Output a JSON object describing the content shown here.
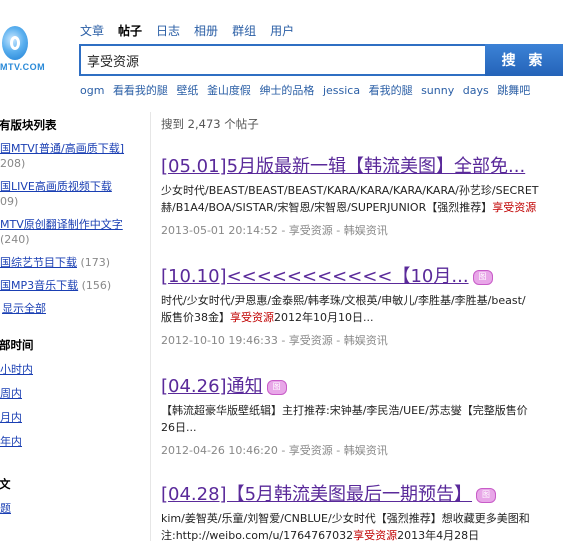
{
  "logo": {
    "text": "MTV.COM"
  },
  "search": {
    "tabs": [
      {
        "label": "文章",
        "active": false
      },
      {
        "label": "帖子",
        "active": true
      },
      {
        "label": "日志",
        "active": false
      },
      {
        "label": "相册",
        "active": false
      },
      {
        "label": "群组",
        "active": false
      },
      {
        "label": "用户",
        "active": false
      }
    ],
    "query": "享受资源",
    "button_label": "搜 索",
    "hot_words": [
      "ogm",
      "看看我的腿",
      "壁纸",
      "釜山度假",
      "绅士的品格",
      "jessica",
      "看我的腿",
      "sunny",
      "days",
      "跳舞吧"
    ]
  },
  "sidebar": {
    "section1_title": "有版块列表",
    "boards": [
      {
        "label": "国MTV[普通/高画质下载]",
        "count": "208)"
      },
      {
        "label": "国LIVE高画质视频下载",
        "count": "09)"
      },
      {
        "label": "MTV原创翻译制作中文字",
        "count": "(240)"
      },
      {
        "label": "国综艺节目下载",
        "count": "(173)"
      },
      {
        "label": "国MP3音乐下载",
        "count": "(156)"
      }
    ],
    "show_all": "显示全部",
    "section2_title": "部时间",
    "time_filters": [
      "小时内",
      "周内",
      "月内",
      "年内"
    ],
    "section3_title": "文",
    "section3_link": "题"
  },
  "results": {
    "count_text": "搜到 2,473 个帖子",
    "items": [
      {
        "title": "[05.01]5月版最新一辑【韩流美图】全部免...",
        "snippet_line1": "少女时代/BEAST/BEAST/BEAST/KARA/KARA/KARA/KARA/孙艺珍/SECRET",
        "snippet_line2_pre": "赫/B1A4/BOA/SISTAR/宋智恩/宋智恩/SUPERJUNIOR【强烈推荐】",
        "snippet_line2_hl": "享受资源",
        "snippet_line2_post": "",
        "meta": "2013-05-01 20:14:52 - 享受资源 - 韩娱资讯"
      },
      {
        "title": "[10.10]<<<<<<<<<<<【10月...",
        "snippet_line1": "时代/少女时代/尹恩惠/金泰熙/韩孝珠/文根英/申敏儿/李胜基/李胜基/beast/",
        "snippet_line2_pre": "版售价38金】",
        "snippet_line2_hl": "享受资源",
        "snippet_line2_post": "2012年10月10日...",
        "meta": "2012-10-10 19:46:33 - 享受资源 - 韩娱资讯"
      },
      {
        "title": "[04.26]通知",
        "snippet_line1": "【韩流超豪华版壁纸辑】主打推荐:宋钟基/李民浩/UEE/苏志燮【完整版售价",
        "snippet_line2_pre": "26日...",
        "snippet_line2_hl": "",
        "snippet_line2_post": "",
        "meta": "2012-04-26 10:46:20 - 享受资源 - 韩娱资讯"
      },
      {
        "title": "[04.28]【5月韩流美图最后一期预告】",
        "snippet_line1": "kim/姜智英/乐童/刘智爱/CNBLUE/少女时代【强烈推荐】想收藏更多美图和",
        "snippet_line2_pre": "注:http://weibo.com/u/1764767032",
        "snippet_line2_hl": "享受资源",
        "snippet_line2_post": "2013年4月28日",
        "meta": ""
      }
    ]
  }
}
